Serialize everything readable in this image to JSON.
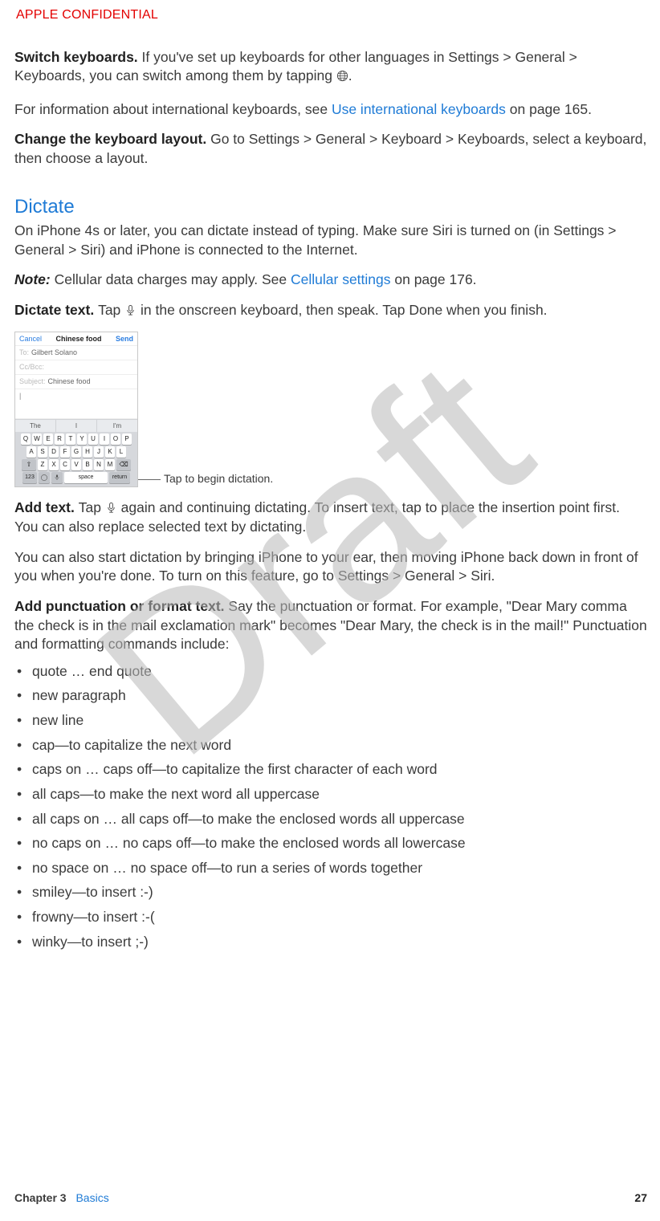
{
  "confidential": " APPLE CONFIDENTIAL",
  "p1": {
    "bold": "Switch keyboards. ",
    "rest_a": "If you've set up keyboards for other languages in Settings > General > Keyboards, you can switch among them by tapping ",
    "rest_b": "."
  },
  "p2": {
    "a": "For information about international keyboards, see ",
    "link": "Use international keyboards",
    "b": " on page 165."
  },
  "p3": {
    "bold": "Change the keyboard layout. ",
    "rest": "Go to Settings > General > Keyboard > Keyboards, select a keyboard, then choose a layout."
  },
  "section1": "Dictate",
  "p4": "On iPhone 4s or later, you can dictate instead of typing. Make sure Siri is turned on (in Settings > General > Siri) and iPhone is connected to the Internet.",
  "p5": {
    "note": "Note:  ",
    "a": "Cellular data charges may apply. See ",
    "link": "Cellular settings",
    "b": " on page 176."
  },
  "p6": {
    "bold": "Dictate text. ",
    "a": "Tap ",
    "b": " in the onscreen keyboard, then speak. Tap Done when you finish."
  },
  "screenshot": {
    "cancel": "Cancel",
    "title": "Chinese food",
    "send": "Send",
    "to_label": "To:",
    "to_value": "Gilbert Solano",
    "cc_label": "Cc/Bcc:",
    "subject_label": "Subject:",
    "subject_value": "Chinese food",
    "cursor": "|",
    "sugg1": "The",
    "sugg2": "I",
    "sugg3": "I'm",
    "row1": [
      "Q",
      "W",
      "E",
      "R",
      "T",
      "Y",
      "U",
      "I",
      "O",
      "P"
    ],
    "row2": [
      "A",
      "S",
      "D",
      "F",
      "G",
      "H",
      "J",
      "K",
      "L"
    ],
    "row3_shift": "⇧",
    "row3": [
      "Z",
      "X",
      "C",
      "V",
      "B",
      "N",
      "M"
    ],
    "row3_del": "⌫",
    "num": "123",
    "space": "space",
    "return": "return",
    "callout": "Tap to begin dictation."
  },
  "p7": {
    "bold": "Add text. ",
    "a": "Tap ",
    "b": " again and continuing dictating. To insert text, tap to place the insertion point first. You can also replace selected text by dictating."
  },
  "p8": "You can also start dictation by bringing iPhone to your ear, then moving iPhone back down in front of you when you're done. To turn on this feature, go to Settings > General > Siri.",
  "p9": {
    "bold": "Add punctuation or format text. ",
    "rest": "Say the punctuation or format. For example, \"Dear Mary comma the check is in the mail exclamation mark\" becomes \"Dear Mary, the check is in the mail!\" Punctuation and formatting commands include:"
  },
  "bullets": [
    "quote … end quote",
    "new paragraph",
    "new line",
    "cap—to capitalize the next word",
    "caps on … caps off—to capitalize the first character of each word",
    "all caps—to make the next word all uppercase",
    "all caps on … all caps off—to make the enclosed words all uppercase",
    "no caps on … no caps off—to make the enclosed words all lowercase",
    "no space on … no space off—to run a series of words together",
    "smiley—to insert :-)",
    "frowny—to insert :-(",
    "winky—to insert ;-)"
  ],
  "footer": {
    "chapter_label": "Chapter  3",
    "chapter_title": "Basics",
    "page": "27"
  },
  "watermark": "Draft"
}
